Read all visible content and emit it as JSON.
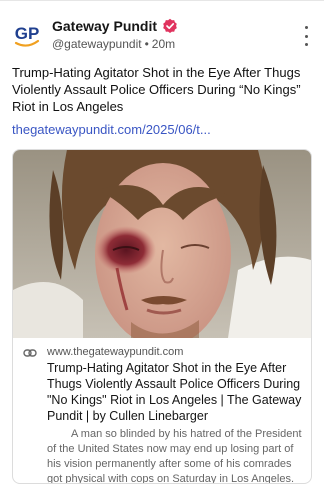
{
  "post": {
    "author_name": "Gateway Pundit",
    "handle": "@gatewaypundit",
    "separator": "•",
    "time_ago": "20m",
    "avatar_text": "GP",
    "text": "Trump-Hating Agitator Shot in the Eye After Thugs Violently Assault Police Officers During “No Kings” Riot in Los Angeles",
    "link_text": "thegatewaypundit.com/2025/06/t..."
  },
  "link_card": {
    "domain": "www.thegatewaypundit.com",
    "title": "Trump-Hating Agitator Shot in the Eye After Thugs Violently Assault Police Officers During \"No Kings\" Riot in Los Angeles | The Gateway Pundit | by Cullen Linebarger",
    "description": "A man so blinded by his hatred of the President of the United States now may end up losing part of his vision permanently after some of his comrades got physical with cops on Saturday in Los Angeles."
  },
  "icons": {
    "verified": "verified-badge-icon",
    "more": "more-vertical-icon",
    "link": "link-icon"
  },
  "colors": {
    "link": "#3a56c4",
    "verified_badge": "#e0335e",
    "avatar_blue": "#1f3f8f",
    "avatar_orange": "#f0a020"
  }
}
